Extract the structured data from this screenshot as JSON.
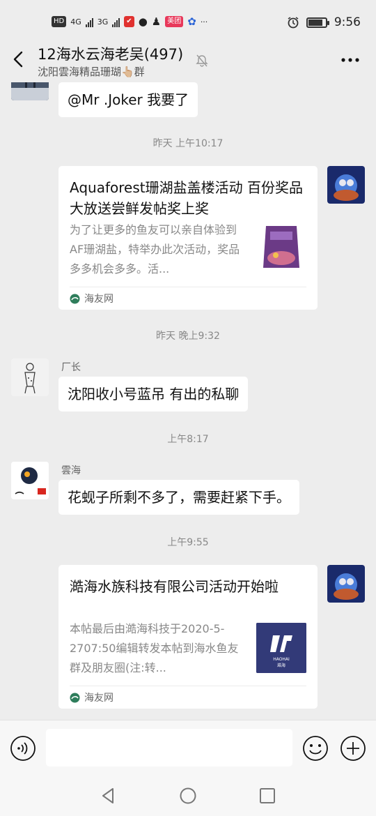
{
  "status_bar": {
    "hd_label": "HD",
    "sim1_label": "4G",
    "sim2_label": "3G",
    "app_badge": "美团",
    "dots": "···",
    "time": "9:56"
  },
  "header": {
    "title": "12海水云海老吴(497)",
    "subtitle": "沈阳雲海精品珊瑚👆🏼群",
    "icons": [
      "back-icon",
      "mute-bell-icon",
      "more-icon"
    ]
  },
  "messages": [
    {
      "type": "text",
      "side": "left",
      "sender": "",
      "text": "@Mr .Joker  我要了"
    },
    {
      "type": "time",
      "text": "昨天 上午10:17"
    },
    {
      "type": "card",
      "side": "right",
      "title": "Aquaforest珊湖盐盖楼活动 百份奖品大放送尝鲜发帖奖上奖",
      "desc": "为了让更多的鱼友可以亲自体验到AF珊湖盐，特举办此次活动，奖品多多机会多多。活...",
      "source": "海友网"
    },
    {
      "type": "time",
      "text": "昨天 晚上9:32"
    },
    {
      "type": "text",
      "side": "left",
      "sender": "厂长",
      "text": "沈阳收小号蓝吊 有出的私聊"
    },
    {
      "type": "time",
      "text": "上午8:17"
    },
    {
      "type": "text",
      "side": "left",
      "sender": "雲海",
      "text": "花蚬子所剩不多了，需要赶紧下手。"
    },
    {
      "type": "time",
      "text": "上午9:55"
    },
    {
      "type": "card",
      "side": "right",
      "title": "澔海水族科技有限公司活动开始啦",
      "desc": "本帖最后由澔海科技于2020-5-2707:50编辑转发本帖到海水鱼友群及朋友圈(注:转...",
      "source": "海友网",
      "thumb_text": "HAOHAI",
      "thumb_sub": "澔海"
    }
  ],
  "input_bar": {
    "placeholder": "",
    "icons": [
      "voice-icon",
      "emoji-icon",
      "plus-icon"
    ]
  },
  "nav_bar": {
    "icons": [
      "back-triangle-icon",
      "home-circle-icon",
      "recents-square-icon"
    ]
  },
  "colors": {
    "background": "#ededed",
    "bubble": "#ffffff",
    "time_text": "#888888",
    "source_green": "#2e7d5b"
  }
}
